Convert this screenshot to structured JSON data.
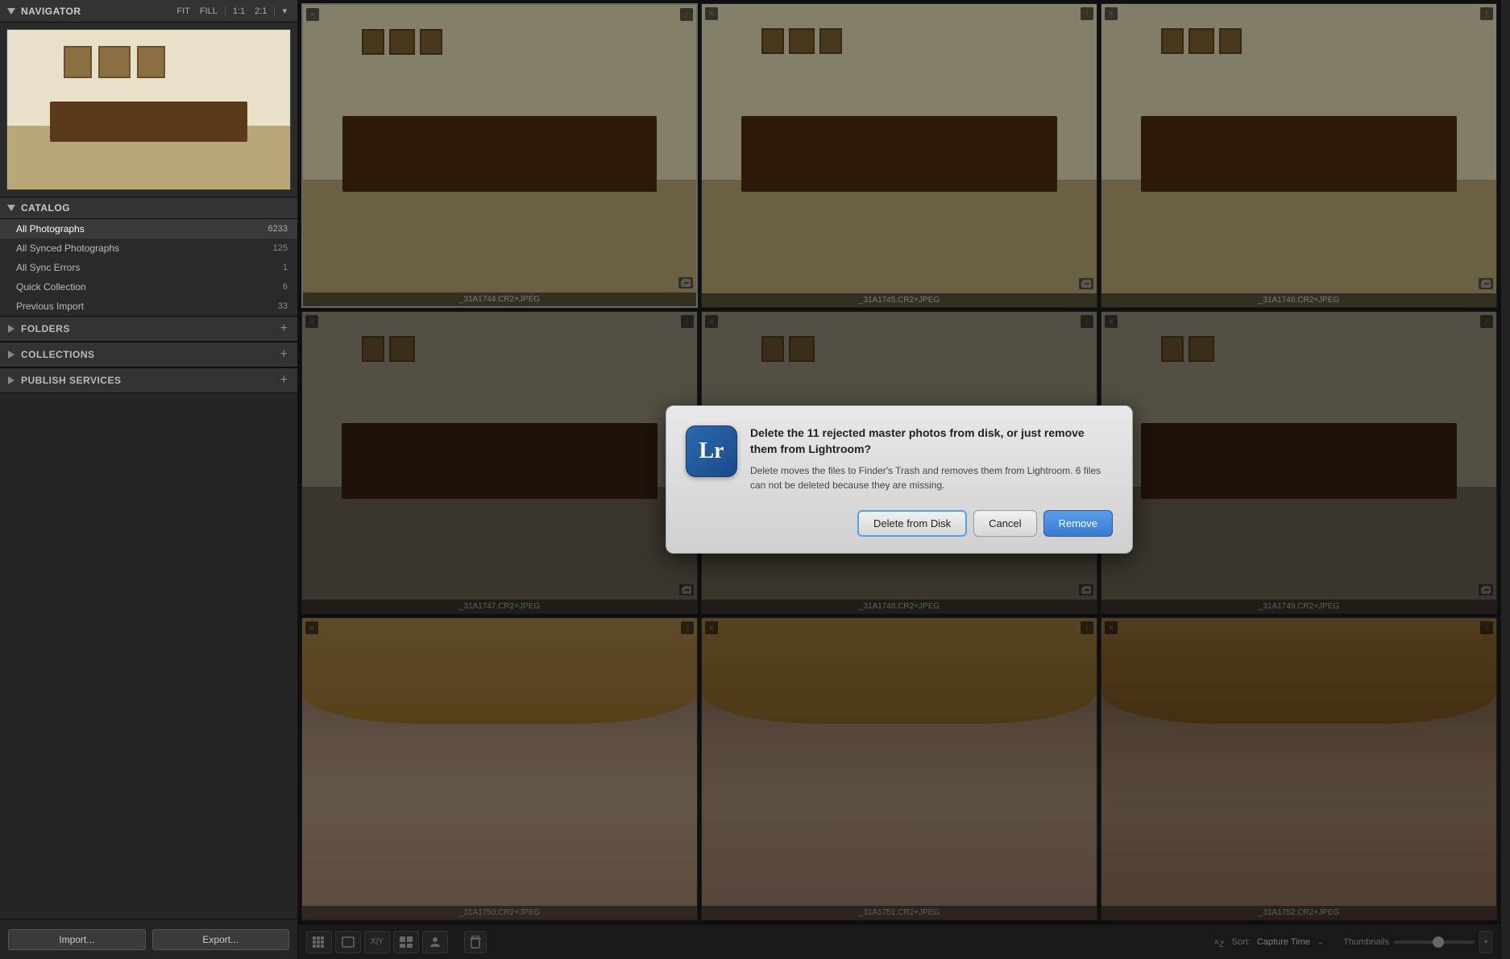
{
  "navigator": {
    "title": "Navigator",
    "controls": [
      "FIT",
      "FILL",
      "1:1",
      "2:1"
    ]
  },
  "catalog": {
    "title": "Catalog",
    "items": [
      {
        "name": "All Photographs",
        "count": "6233",
        "active": true
      },
      {
        "name": "All Synced Photographs",
        "count": "125",
        "active": false
      },
      {
        "name": "All Sync Errors",
        "count": "1",
        "active": false
      },
      {
        "name": "Quick Collection",
        "count": "6",
        "active": false
      },
      {
        "name": "Previous Import",
        "count": "33",
        "active": false
      }
    ]
  },
  "folders": {
    "title": "Folders"
  },
  "collections": {
    "title": "Collections"
  },
  "publishServices": {
    "title": "Publish Services"
  },
  "toolbar": {
    "import_label": "Import...",
    "export_label": "Export..."
  },
  "photos": [
    {
      "filename": "_31A1744.CR2+JPEG",
      "selected": true,
      "row": 1
    },
    {
      "filename": "_31A1745.CR2+JPEG",
      "selected": false,
      "row": 1
    },
    {
      "filename": "_31A1746.CR2+JPEG",
      "selected": false,
      "row": 1
    },
    {
      "filename": "_31A1747.CR2+JPEG",
      "selected": false,
      "row": 2
    },
    {
      "filename": "_31A1748.CR2+JPEG",
      "selected": false,
      "row": 2
    },
    {
      "filename": "_31A1749.CR2+JPEG",
      "selected": false,
      "row": 2
    },
    {
      "filename": "_31A1750.CR2+JPEG",
      "selected": false,
      "row": 3
    },
    {
      "filename": "_31A1751.CR2+JPEG",
      "selected": false,
      "row": 3
    },
    {
      "filename": "_31A1752.CR2+JPEG",
      "selected": false,
      "row": 3
    }
  ],
  "bottomBar": {
    "sort_label": "Sort:",
    "sort_value": "Capture Time",
    "thumbnails_label": "Thumbnails"
  },
  "dialog": {
    "icon_text": "Lr",
    "title": "Delete the 11 rejected master photos from disk, or just remove them from Lightroom?",
    "message": "Delete moves the files to Finder's Trash and removes them from Lightroom.  6 files can not be deleted because they are missing.",
    "btn_delete": "Delete from Disk",
    "btn_cancel": "Cancel",
    "btn_remove": "Remove"
  }
}
